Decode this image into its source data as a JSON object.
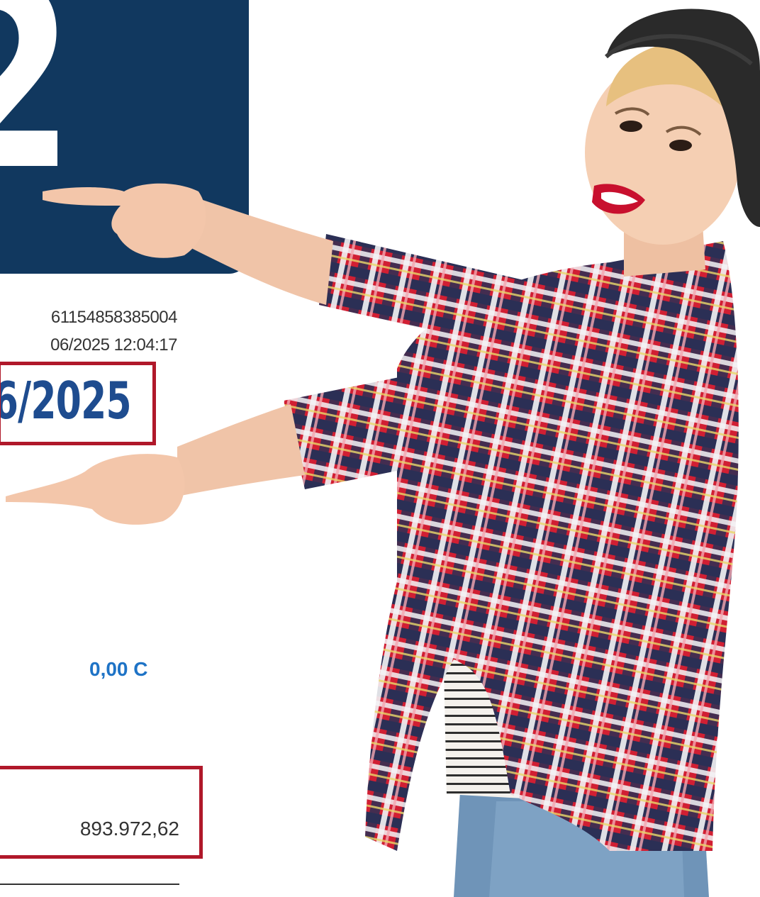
{
  "tile": {
    "number": "2"
  },
  "document": {
    "id_fragment": "611548583850​04",
    "datetime_fragment": "06/2025 12:04:17",
    "date_highlight": "6/2025",
    "amount_blue": "0,00 C",
    "total_amount": "893.972,62"
  },
  "colors": {
    "navy": "#11385f",
    "highlight_border": "#b0182a",
    "date_blue": "#1e4c8f",
    "amount_blue": "#1e73c6",
    "text_gray": "#333333"
  },
  "illustration": {
    "subject": "woman-pointing-left",
    "icon": "person-photo-icon"
  }
}
